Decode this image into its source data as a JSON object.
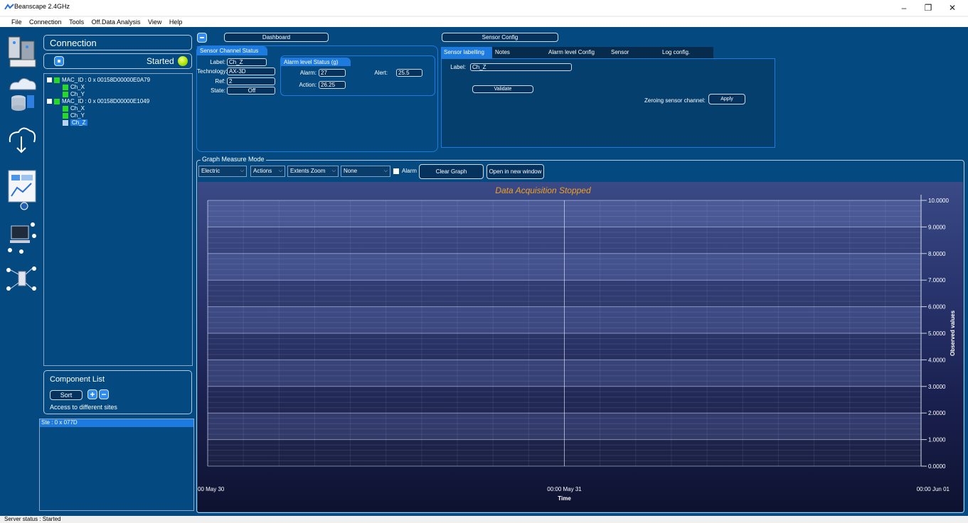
{
  "window": {
    "title": "Beanscape 2.4GHz",
    "minimize": "–",
    "restore": "❐",
    "close": "✕"
  },
  "menu": [
    "File",
    "Connection",
    "Tools",
    "Off.Data Analysis",
    "View",
    "Help"
  ],
  "left_panel": {
    "connection_title": "Connection",
    "connection_state": "Started",
    "tree": [
      {
        "label": "MAC_ID : 0 x 00158D00000E0A79",
        "level": 0
      },
      {
        "label": "Ch_X",
        "level": 1
      },
      {
        "label": "Ch_Y",
        "level": 1
      },
      {
        "label": "MAC_ID : 0 x 00158D00000E1049",
        "level": 0
      },
      {
        "label": "Ch_X",
        "level": 1
      },
      {
        "label": "Ch_Y",
        "level": 1
      },
      {
        "label": "Ch_Z",
        "level": 1,
        "selected": true
      }
    ],
    "component_list_title": "Component List",
    "sort_label": "Sort",
    "plus_glyph": "+",
    "minus_glyph": "−",
    "access_label": "Access to different sites",
    "site_item": "Ste : 0 x 077D"
  },
  "sidebar_icons": [
    "server-icon",
    "cloud-database-icon",
    "cloud-download-icon",
    "dashboard-icon",
    "network-computer-icon",
    "network-nodes-icon"
  ],
  "dashboard": {
    "button_label": "Dashboard",
    "sensor_channel_tab": "Sensor Channel Status",
    "label_lbl": "Label:",
    "label_val": "Ch_Z",
    "tech_lbl": "Technology:",
    "tech_val": "AX-3D",
    "ref_lbl": "Ref:",
    "ref_val": "2",
    "state_lbl": "State:",
    "state_val": "Off",
    "alarm_tab": "Alarm level Status (g)",
    "alarm_lbl": "Alarm:",
    "alarm_val": "27",
    "alert_lbl": "Alert:",
    "alert_val": "25.5",
    "action_lbl": "Action:",
    "action_val": "26.25"
  },
  "sensor_config": {
    "button_label": "Sensor Config",
    "tabs": [
      "Sensor labelling",
      "Notes",
      "Alarm level Config",
      "Sensor calibration",
      "Log config."
    ],
    "label_lbl": "Label:",
    "label_val": "Ch_Z",
    "validate_label": "Validate",
    "zeroing_label": "Zeroing sensor channel:",
    "apply_label": "Apply"
  },
  "graph_mode": {
    "title": "Graph Measure Mode",
    "combo1": "Electric",
    "combo2": "Actions",
    "combo3": "Extents Zoom",
    "combo4": "None",
    "alarm_label": "Alarm",
    "clear_label": "Clear Graph",
    "open_label": "Open in new window"
  },
  "chart_data": {
    "type": "line",
    "title": "Data Acquisition Stopped",
    "xlabel": "Time",
    "ylabel": "Observed values",
    "x_ticks": [
      "00 May 30",
      "00:00 May 31",
      "00:00 Jun 01"
    ],
    "y_ticks": [
      "0.0000",
      "1.0000",
      "2.0000",
      "3.0000",
      "4.0000",
      "5.0000",
      "6.0000",
      "7.0000",
      "8.0000",
      "9.0000",
      "10.0000"
    ],
    "ylim": [
      0,
      10
    ],
    "series": [],
    "grid": true,
    "title_color": "#f0a020"
  },
  "status_text": "Server status : Started"
}
